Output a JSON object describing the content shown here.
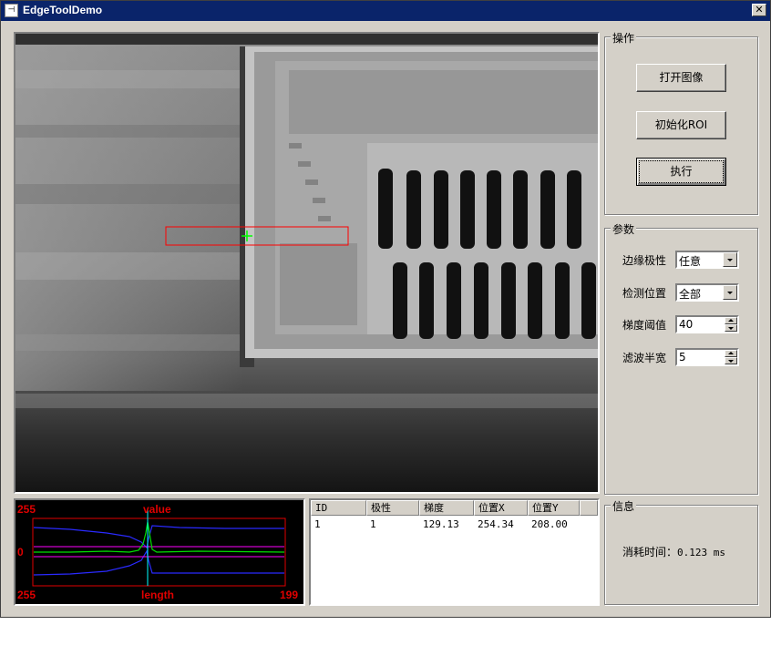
{
  "window": {
    "title": "EdgeToolDemo",
    "icon_glyph": "⊣",
    "close_glyph": "✕"
  },
  "groups": {
    "operations": "操作",
    "params": "参数",
    "info": "信息"
  },
  "buttons": {
    "open_image": "打开图像",
    "init_roi": "初始化ROI",
    "execute": "执行"
  },
  "params": {
    "edge_polarity_label": "边缘极性",
    "edge_polarity_value": "任意",
    "detect_position_label": "检测位置",
    "detect_position_value": "全部",
    "gradient_threshold_label": "梯度阈值",
    "gradient_threshold_value": "40",
    "filter_halfwidth_label": "滤波半宽",
    "filter_halfwidth_value": "5"
  },
  "profile": {
    "top_left": "255",
    "top_center": "value",
    "mid_left": "0",
    "bottom_left": "255",
    "bottom_center": "length",
    "bottom_right": "199"
  },
  "table": {
    "columns": [
      "ID",
      "极性",
      "梯度",
      "位置X",
      "位置Y"
    ],
    "rows": [
      [
        "1",
        "1",
        "129.13",
        "254.34",
        "208.00"
      ]
    ]
  },
  "info": {
    "elapsed_label": "消耗时间：",
    "elapsed_value": "0.123 ms"
  },
  "colors": {
    "titlebar": "#0a246a",
    "face": "#d4d0c8",
    "roi": "#ff0000",
    "edge_marker": "#00ff00"
  }
}
